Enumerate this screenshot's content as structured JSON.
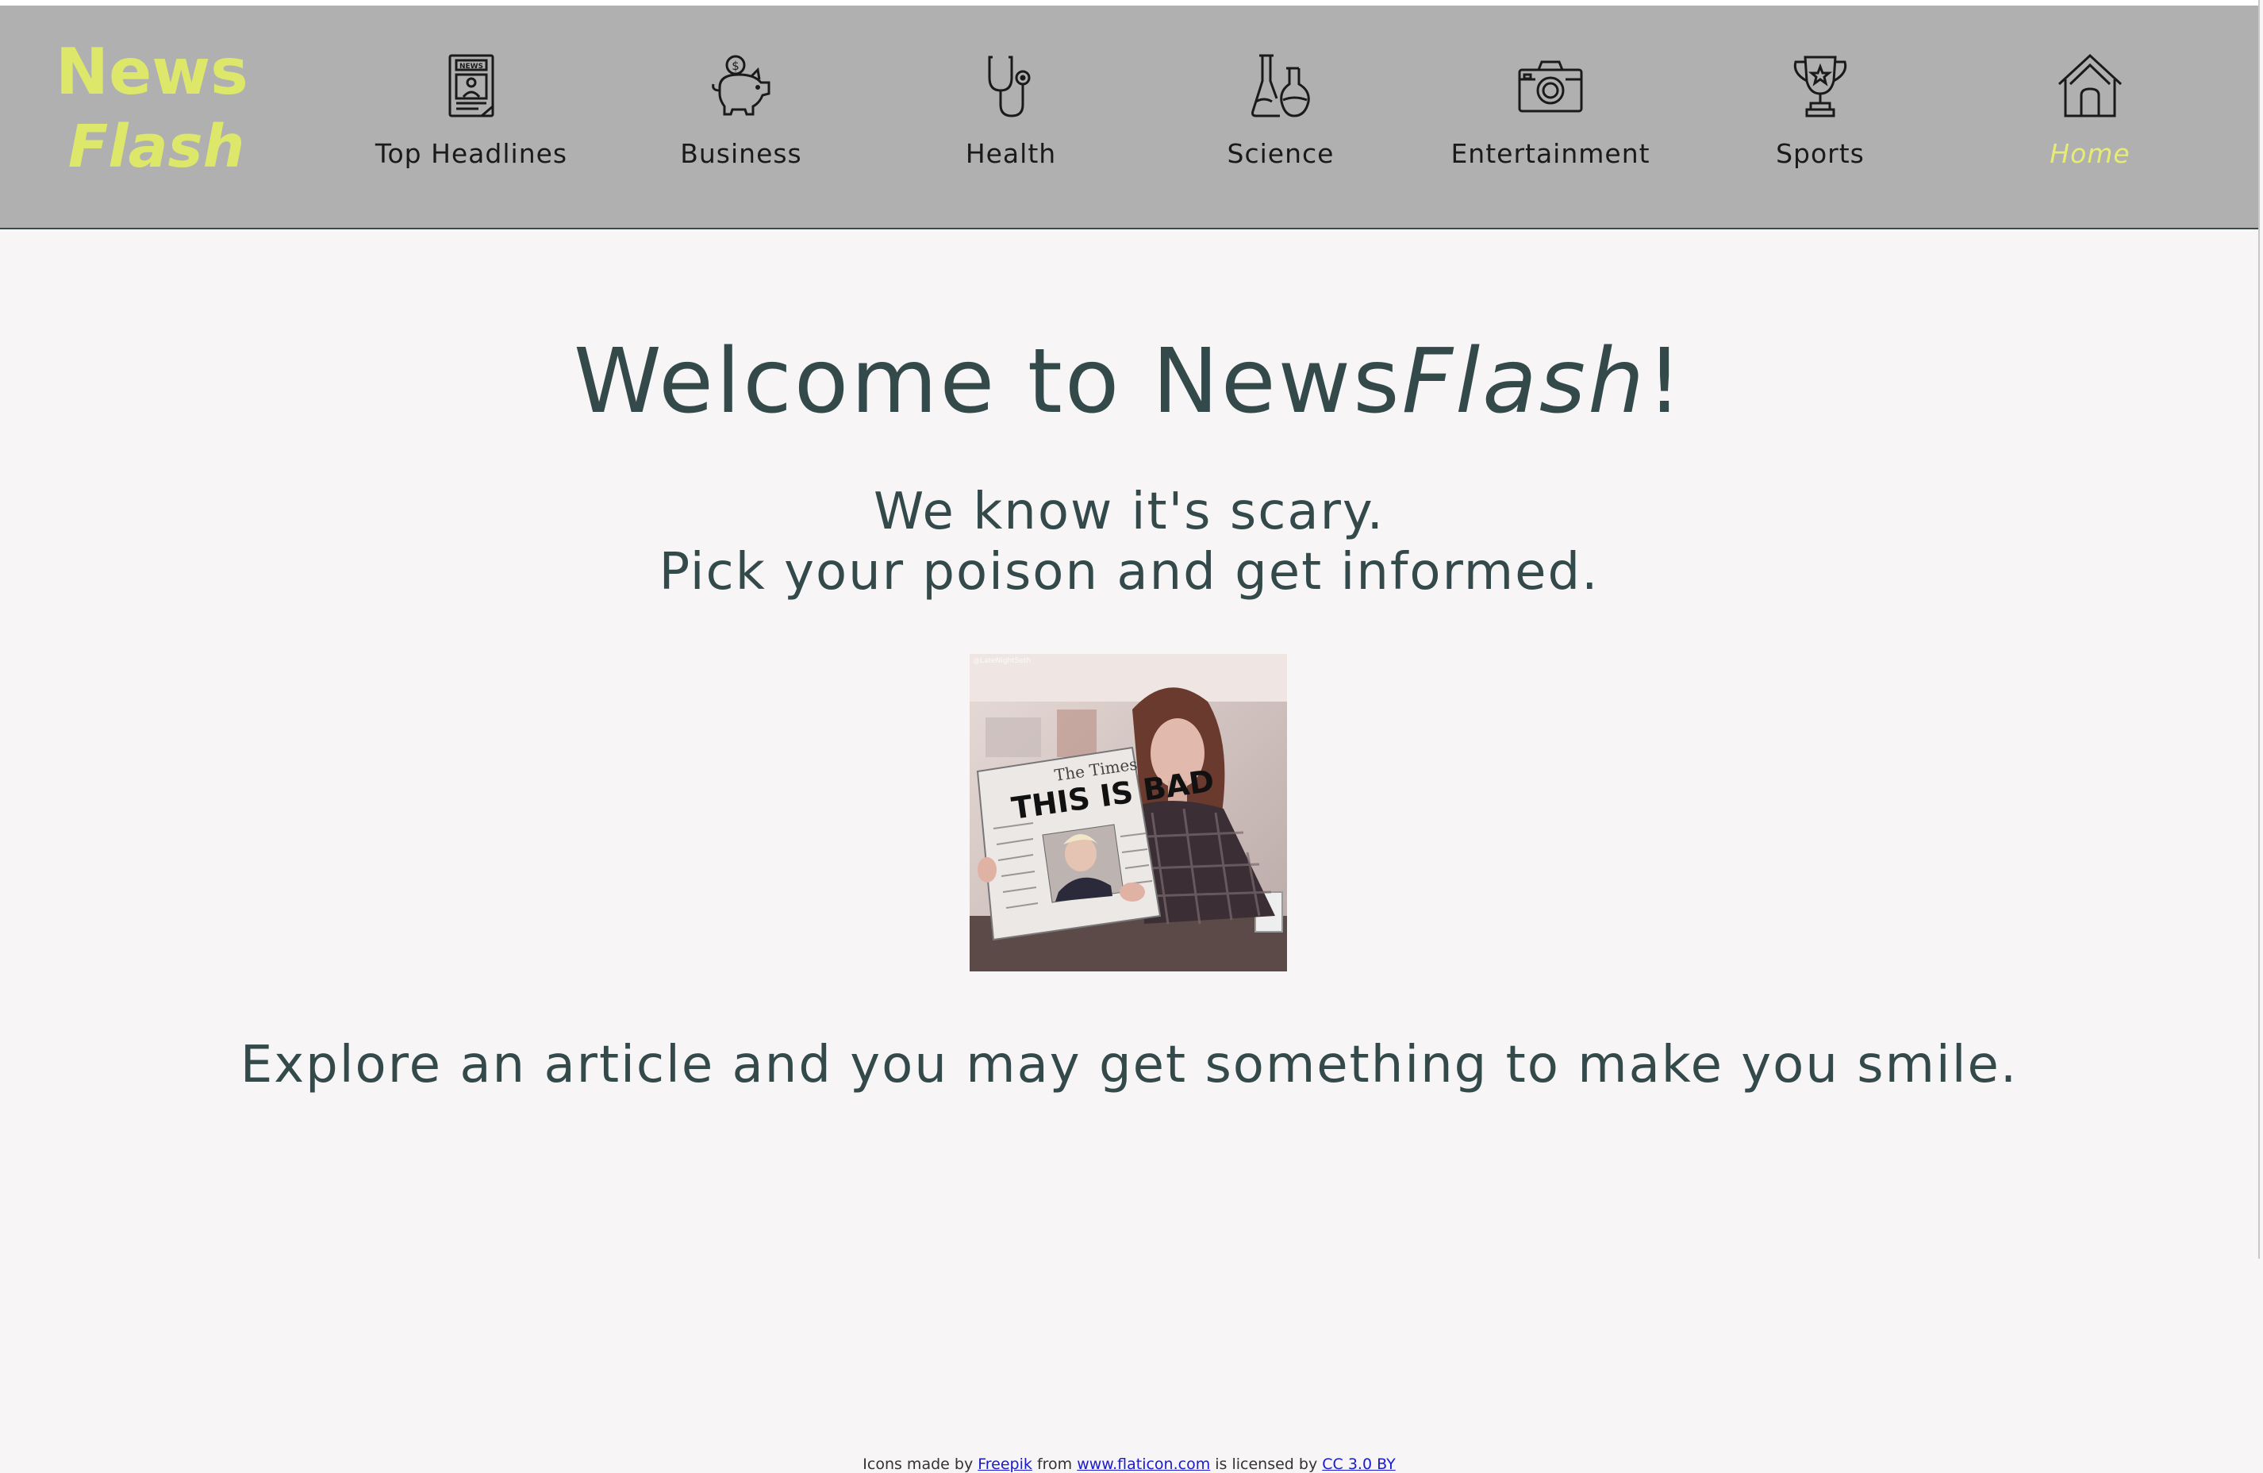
{
  "logo": {
    "line1": "News",
    "line2": "Flash"
  },
  "nav": {
    "items": [
      {
        "label": "Top Headlines",
        "icon": "newspaper-icon"
      },
      {
        "label": "Business",
        "icon": "piggy-bank-icon"
      },
      {
        "label": "Health",
        "icon": "stethoscope-icon"
      },
      {
        "label": "Science",
        "icon": "flasks-icon"
      },
      {
        "label": "Entertainment",
        "icon": "camera-icon"
      },
      {
        "label": "Sports",
        "icon": "trophy-icon"
      },
      {
        "label": "Home",
        "icon": "home-icon",
        "active": true
      }
    ]
  },
  "main": {
    "welcome_prefix": "Welcome to News",
    "welcome_brand": "Flash",
    "welcome_suffix": "!",
    "tagline_line1": "We know it's scary.",
    "tagline_line2": "Pick your poison and get informed.",
    "image": {
      "newspaper_name": "The Times",
      "headline": "THIS IS BAD",
      "watermark": "@LateNightSeth"
    },
    "explore": "Explore an article and you may get something to make you smile."
  },
  "footer": {
    "prefix": "Icons made by",
    "author": "Freepik",
    "middle": "from",
    "site": "www.flaticon.com",
    "license_prefix": "is licensed by",
    "license": "CC 3.0 BY"
  },
  "colors": {
    "navbar_bg": "#b0b0b0",
    "logo": "#dde86a",
    "active_nav": "#e6ec73",
    "main_text": "#344a4a",
    "page_bg": "#f7f5f6",
    "link": "#1a1ad0"
  }
}
